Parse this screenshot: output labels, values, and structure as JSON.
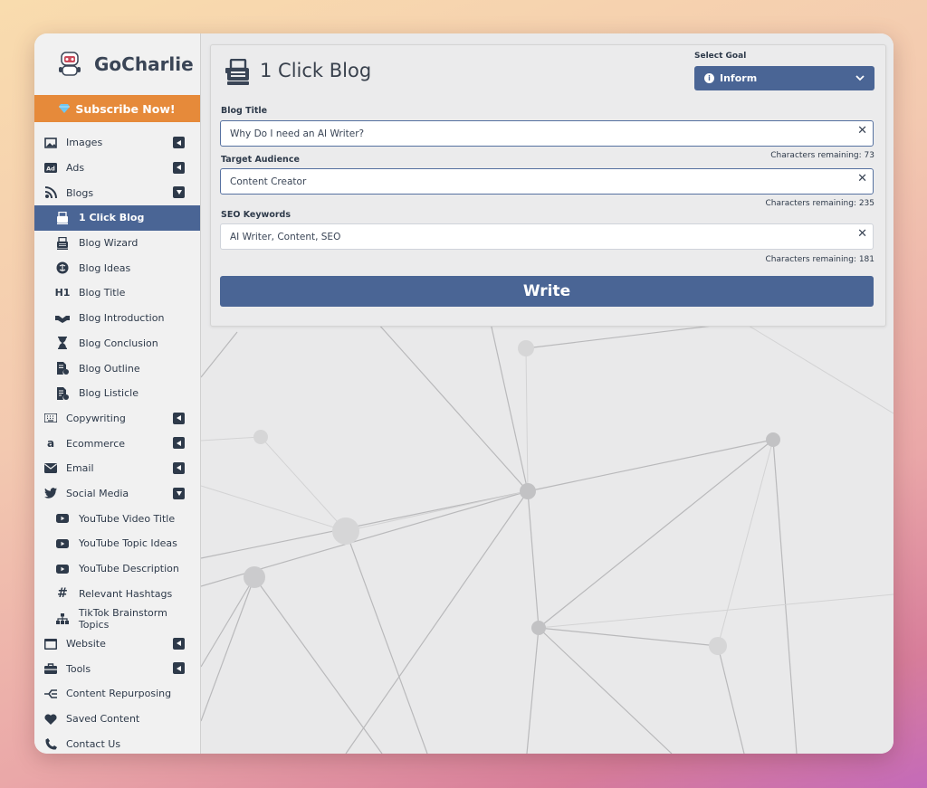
{
  "brand": {
    "name": "GoCharlie"
  },
  "subscribe": {
    "label": "Subscribe Now!"
  },
  "sidebar": {
    "items": [
      {
        "name": "images",
        "label": "Images",
        "icon": "image-icon",
        "caret": "left"
      },
      {
        "name": "ads",
        "label": "Ads",
        "icon": "ad-icon",
        "caret": "left"
      },
      {
        "name": "blogs",
        "label": "Blogs",
        "icon": "blog-icon",
        "caret": "down"
      },
      {
        "name": "1-click-blog",
        "label": "1 Click Blog",
        "icon": "typewriter-icon",
        "sub": true,
        "active": true
      },
      {
        "name": "blog-wizard",
        "label": "Blog Wizard",
        "icon": "typewriter-icon",
        "sub": true
      },
      {
        "name": "blog-ideas",
        "label": "Blog Ideas",
        "icon": "brain-icon",
        "sub": true
      },
      {
        "name": "blog-title",
        "label": "Blog Title",
        "icon": "heading-icon",
        "sub": true
      },
      {
        "name": "blog-introduction",
        "label": "Blog Introduction",
        "icon": "handshake-icon",
        "sub": true
      },
      {
        "name": "blog-conclusion",
        "label": "Blog Conclusion",
        "icon": "hourglass-icon",
        "sub": true
      },
      {
        "name": "blog-outline",
        "label": "Blog Outline",
        "icon": "document-icon",
        "sub": true
      },
      {
        "name": "blog-listicle",
        "label": "Blog Listicle",
        "icon": "document-list-icon",
        "sub": true
      },
      {
        "name": "copywriting",
        "label": "Copywriting",
        "icon": "keyboard-icon",
        "caret": "left"
      },
      {
        "name": "ecommerce",
        "label": "Ecommerce",
        "icon": "amazon-icon",
        "caret": "left"
      },
      {
        "name": "email",
        "label": "Email",
        "icon": "envelope-icon",
        "caret": "left"
      },
      {
        "name": "social-media",
        "label": "Social Media",
        "icon": "twitter-icon",
        "caret": "down"
      },
      {
        "name": "youtube-video-title",
        "label": "YouTube Video Title",
        "icon": "youtube-icon",
        "sub": true
      },
      {
        "name": "youtube-topic-ideas",
        "label": "YouTube Topic Ideas",
        "icon": "youtube-icon",
        "sub": true
      },
      {
        "name": "youtube-description",
        "label": "YouTube Description",
        "icon": "youtube-icon",
        "sub": true
      },
      {
        "name": "relevant-hashtags",
        "label": "Relevant Hashtags",
        "icon": "hashtag-icon",
        "sub": true
      },
      {
        "name": "tiktok-brainstorm-topics",
        "label": "TikTok Brainstorm Topics",
        "icon": "sitemap-icon",
        "sub": true
      },
      {
        "name": "website",
        "label": "Website",
        "icon": "browser-icon",
        "caret": "left"
      },
      {
        "name": "tools",
        "label": "Tools",
        "icon": "toolbox-icon",
        "caret": "left"
      },
      {
        "name": "content-repurposing",
        "label": "Content Repurposing",
        "icon": "branch-icon"
      },
      {
        "name": "saved-content",
        "label": "Saved Content",
        "icon": "heart-icon"
      },
      {
        "name": "contact-us",
        "label": "Contact Us",
        "icon": "phone-icon"
      }
    ]
  },
  "main": {
    "title": "1 Click Blog",
    "goal": {
      "label": "Select Goal",
      "value": "Inform"
    },
    "fields": {
      "blog_title": {
        "label": "Blog Title",
        "value": "Why Do I need an AI Writer?",
        "remaining": "Characters remaining: 73"
      },
      "target_audience": {
        "label": "Target Audience",
        "value": "Content Creator",
        "remaining": "Characters remaining: 235"
      },
      "seo_keywords": {
        "label": "SEO Keywords",
        "value": "AI Writer, Content, SEO",
        "remaining": "Characters remaining: 181"
      }
    },
    "write_label": "Write"
  },
  "colors": {
    "accent": "#4a6595",
    "subscribe": "#e68a3a",
    "text": "#2e3a4a"
  }
}
